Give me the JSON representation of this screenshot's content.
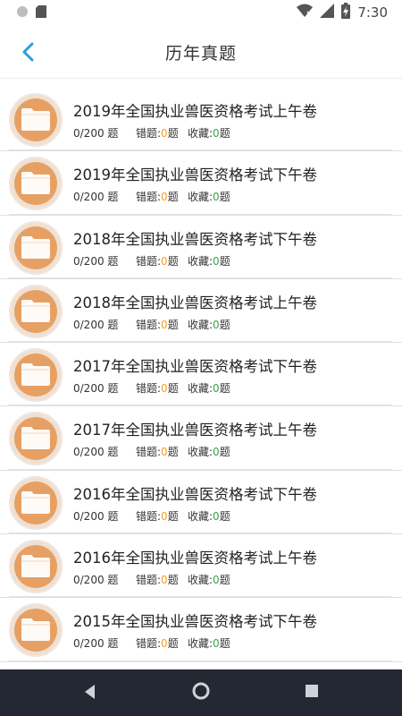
{
  "status_bar": {
    "time": "7:30",
    "icons": [
      "circle-icon",
      "sd-card-icon",
      "wifi-icon",
      "signal-icon",
      "battery-charging-icon"
    ]
  },
  "header": {
    "title": "历年真题",
    "back_icon": "chevron-left-icon"
  },
  "labels": {
    "wrong": "错题:",
    "favorite": "收藏:",
    "unit": "题"
  },
  "papers": [
    {
      "title": "2019年全国执业兽医资格考试上午卷",
      "progress": "0/200 题",
      "wrong": "0",
      "fav": "0"
    },
    {
      "title": "2019年全国执业兽医资格考试下午卷",
      "progress": "0/200 题",
      "wrong": "0",
      "fav": "0"
    },
    {
      "title": "2018年全国执业兽医资格考试下午卷",
      "progress": "0/200 题",
      "wrong": "0",
      "fav": "0"
    },
    {
      "title": "2018年全国执业兽医资格考试上午卷",
      "progress": "0/200 题",
      "wrong": "0",
      "fav": "0"
    },
    {
      "title": "2017年全国执业兽医资格考试下午卷",
      "progress": "0/200 题",
      "wrong": "0",
      "fav": "0"
    },
    {
      "title": "2017年全国执业兽医资格考试上午卷",
      "progress": "0/200 题",
      "wrong": "0",
      "fav": "0"
    },
    {
      "title": "2016年全国执业兽医资格考试下午卷",
      "progress": "0/200 题",
      "wrong": "0",
      "fav": "0"
    },
    {
      "title": "2016年全国执业兽医资格考试上午卷",
      "progress": "0/200 题",
      "wrong": "0",
      "fav": "0"
    },
    {
      "title": "2015年全国执业兽医资格考试下午卷",
      "progress": "0/200 题",
      "wrong": "0",
      "fav": "0"
    }
  ],
  "colors": {
    "accent": "#2a9fd6",
    "folder": "#e6a063",
    "wrong_count": "#f0a030",
    "fav_count": "#3aa34a",
    "nav_bar": "#232833"
  },
  "nav": {
    "back": "triangle-back-icon",
    "home": "circle-home-icon",
    "recents": "square-recents-icon"
  }
}
